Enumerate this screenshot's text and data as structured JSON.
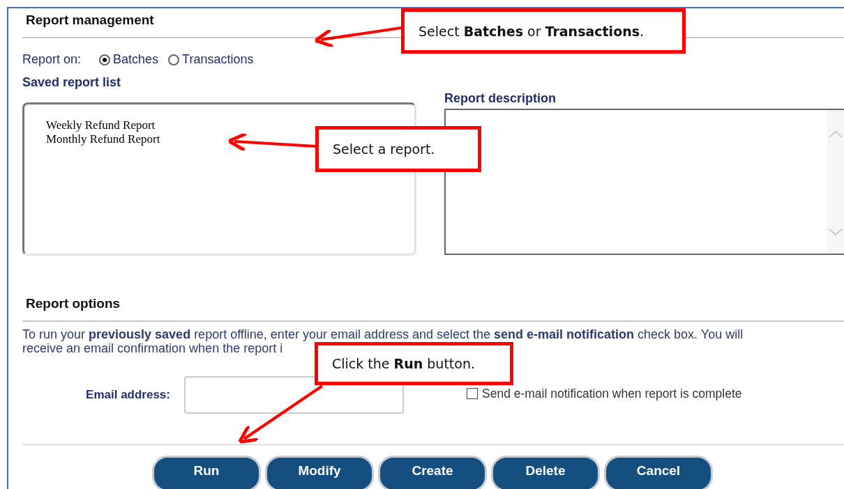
{
  "panel": {
    "title": "Report management"
  },
  "report_on": {
    "label": "Report on:",
    "options": [
      {
        "label": "Batches",
        "selected": true
      },
      {
        "label": "Transactions",
        "selected": false
      }
    ]
  },
  "saved_list": {
    "label": "Saved report list",
    "items": [
      "Weekly Refund Report",
      "Monthly Refund Report"
    ]
  },
  "description": {
    "label": "Report description"
  },
  "options": {
    "title": "Report options",
    "text": "To run your **previously saved** report offline, enter your email address and select the **send e-mail notification** check box. You will receive an email confirmation when the report i",
    "email_label": "Email address:",
    "notify": {
      "label": "Send e-mail notification when report is complete",
      "checked": false
    }
  },
  "buttons": [
    "Run",
    "Modify",
    "Create",
    "Delete",
    "Cancel"
  ],
  "callouts": [
    "Select **Batches** or **Transactions**.",
    "Select a report.",
    "Click the **Run** button."
  ]
}
